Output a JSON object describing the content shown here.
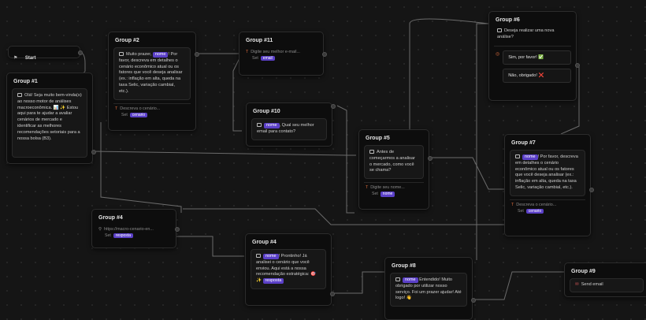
{
  "start": {
    "label": "Start"
  },
  "group1": {
    "title": "Group #1",
    "message": "Olá! Seja muito bem-vinda(o) ao nosso motor de análises macroeconômica. 📊 ✨ Estou aqui para te ajudar a avaliar cenários de mercado e identificar as melhores recomendações setoriais para a nossa bolsa (B3)."
  },
  "group2": {
    "title": "Group #2",
    "prefix": "Muito prazer,",
    "var": "nome",
    "suffix": "! Por favor, descreva em detalhes o cenário econômico atual ou os fatores que você deseja analisar (ex.: inflação em alta, queda na taxa Selic, variação cambial, etc.).",
    "input_placeholder": "Descreva o cenário...",
    "set_label": "Set",
    "set_var": "cenario"
  },
  "group11": {
    "title": "Group #11",
    "input_placeholder": "Digite seu melhor e-mail...",
    "set_label": "Set",
    "set_var": "email"
  },
  "group10": {
    "title": "Group #10",
    "var": "nome",
    "message": ", Qual seu melhor email para contato?"
  },
  "group5": {
    "title": "Group #5",
    "message": "Antes de começarmos a analisar o mercado, como você se chama?",
    "input_placeholder": "Digite seu nome...",
    "set_label": "Set",
    "set_var": "nome"
  },
  "group6": {
    "title": "Group #6",
    "question": "Deseja realizar uma nova análise?",
    "choice1": "Sim, por favor! ✅",
    "choice2": "Não, obrigado! ❌"
  },
  "group7": {
    "title": "Group #7",
    "var": "nome",
    "message": "! Por favor, descreva em detalhes o cenário econômico atual ou os fatores que você deseja analisar (ex.: inflação em alta, queda na taxa Selic, variação cambial, etc.).",
    "input_placeholder": "Descreva o cenário...",
    "set_label": "Set",
    "set_var": "cenario"
  },
  "group4a": {
    "title": "Group #4",
    "url": "https://macro-cenario-en...",
    "set_label": "Set",
    "set_var": "resposta"
  },
  "group4b": {
    "title": "Group #4",
    "var": "nome",
    "message": "! Prontinho! Já analisei o cenário que você enviou. Aqui está a nossa recomendação estratégica: 🎯 ✨",
    "var2": "resposta"
  },
  "group8": {
    "title": "Group #8",
    "var": "nome",
    "message": "Entendido! Muito obrigado por utilizar nosso serviço. Foi um prazer ajudar! Até logo! 👋"
  },
  "group9": {
    "title": "Group #9",
    "action": "Send email"
  }
}
